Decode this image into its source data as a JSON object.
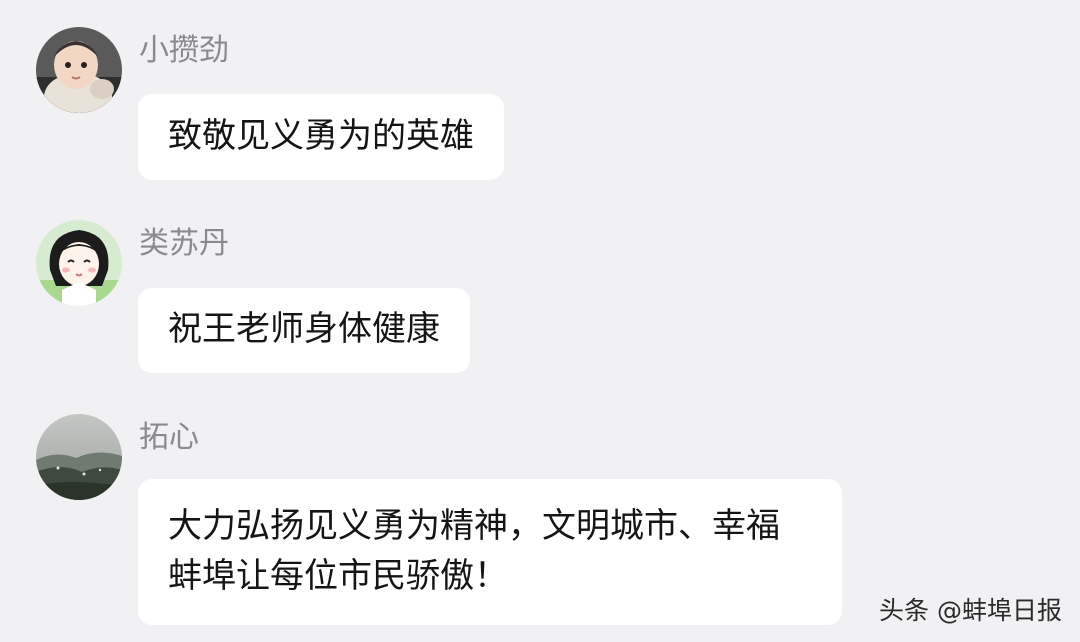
{
  "messages": [
    {
      "sender": "小攒劲",
      "avatar_icon": "baby-photo-avatar-icon",
      "lines": [
        "致敬见义勇为的英雄"
      ]
    },
    {
      "sender": "类苏丹",
      "avatar_icon": "cartoon-girl-avatar-icon",
      "lines": [
        "祝王老师身体健康"
      ]
    },
    {
      "sender": "拓心",
      "avatar_icon": "landscape-photo-avatar-icon",
      "lines": [
        "大力弘扬见义勇为精神，文明城市、幸福",
        "蚌埠让每位市民骄傲！"
      ]
    }
  ],
  "watermark": "头条 @蚌埠日报"
}
